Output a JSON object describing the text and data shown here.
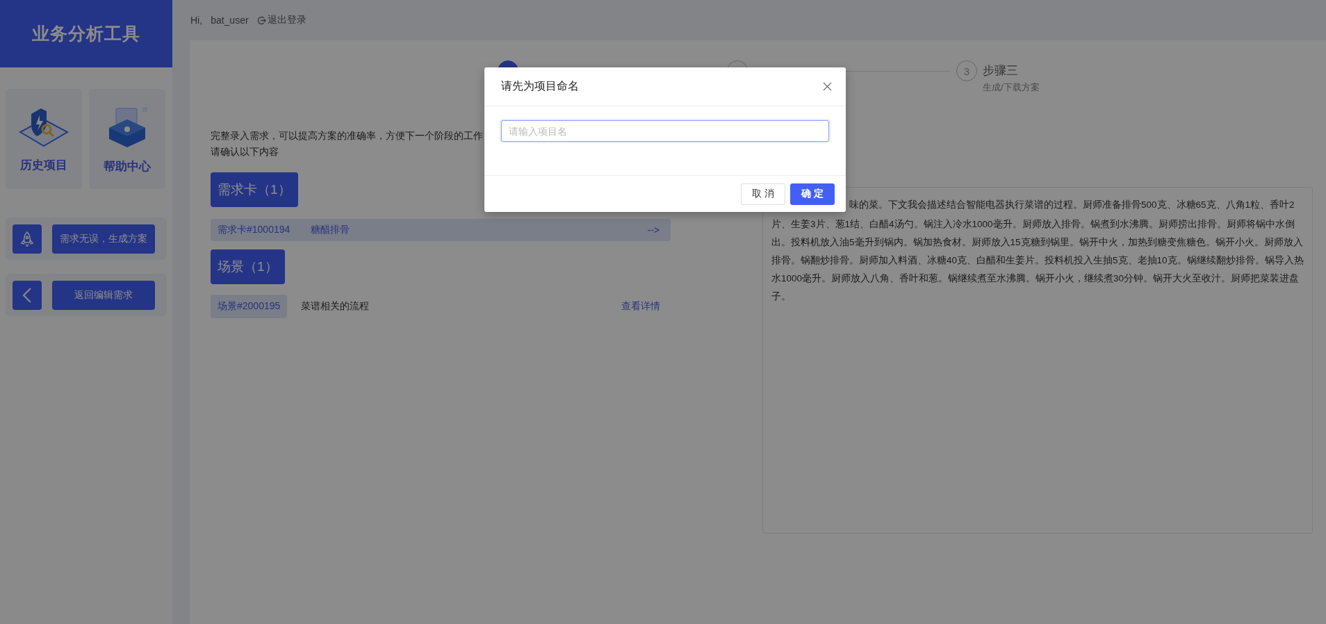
{
  "sidebar": {
    "title": "业务分析工具",
    "tiles": [
      {
        "kind": "history",
        "label": "历史项目"
      },
      {
        "kind": "help",
        "label": "帮助中心"
      }
    ],
    "actions": [
      {
        "kind": "rocket",
        "label": "需求无误，生成方案"
      },
      {
        "kind": "back",
        "label": "返回编辑需求"
      }
    ]
  },
  "top_bar": {
    "greeting": "Hi,",
    "user": "bat_user",
    "logout": "退出登录"
  },
  "steps": [
    {
      "active": true
    },
    {
      "active": false
    },
    {
      "active": false,
      "number": "3",
      "title": "步骤三",
      "description": "生成/下载方案"
    }
  ],
  "intro": [
    "完整录入需求，可以提高方案的准确率，方便下一个阶段的工作",
    "请确认以下内容"
  ],
  "requirement_cards": {
    "heading": "需求卡（1）",
    "items": [
      {
        "id": "需求卡#1000194",
        "name": "糖醋排骨",
        "action": "-->"
      }
    ]
  },
  "scenes": {
    "heading": "场景（1）",
    "items": [
      {
        "id": "场景#2000195",
        "name": "菜谱相关的流程",
        "action": "查看详情"
      }
    ]
  },
  "description_first_line": "味的菜。下文我会描述结合智能电器执行菜谱的过程。厨师准备排骨500克、冰糖65克、八角1粒、香叶2",
  "description": "片、生姜3片、葱1结、白醋4汤勺。锅注入冷水1000毫升。厨师放入排骨。锅煮到水沸腾。厨师捞出排骨。厨师将锅中水倒出。投料机放入油5毫升到锅内。锅加热食材。厨师放入15克糖到锅里。锅开中火，加热到糖变焦糖色。锅开小火。厨师放入排骨。锅翻炒排骨。厨师加入料酒、冰糖40克、白醋和生姜片。投料机投入生抽5克、老抽10克。锅继续翻炒排骨。锅导入热水1000毫升。厨师放入八角、香叶和葱。锅继续煮至水沸腾。锅开小火，继续煮30分钟。锅开大火至收汁。厨师把菜装进盘子。",
  "dialog": {
    "title": "请先为项目命名",
    "placeholder": "请输入项目名",
    "buttons": [
      {
        "kind": "cancel",
        "label": "取 消"
      },
      {
        "kind": "primary",
        "label": "确 定"
      }
    ]
  }
}
